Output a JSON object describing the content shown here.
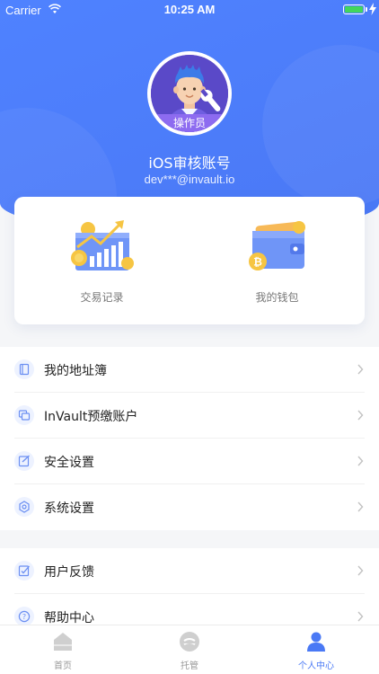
{
  "status_bar": {
    "carrier": "Carrier",
    "time": "10:25 AM"
  },
  "profile": {
    "role_badge": "操作员",
    "name": "iOS审核账号",
    "email": "dev***@invault.io"
  },
  "quick_actions": [
    {
      "label": "交易记录",
      "icon": "transaction-chart-icon"
    },
    {
      "label": "我的钱包",
      "icon": "wallet-icon"
    }
  ],
  "menu_groups": [
    [
      {
        "label": "我的地址簿",
        "icon": "address-book-icon"
      },
      {
        "label": "InVault预缴账户",
        "icon": "account-cards-icon"
      },
      {
        "label": "安全设置",
        "icon": "security-edit-icon"
      },
      {
        "label": "系统设置",
        "icon": "gear-icon"
      }
    ],
    [
      {
        "label": "用户反馈",
        "icon": "feedback-icon"
      },
      {
        "label": "帮助中心",
        "icon": "question-icon"
      }
    ]
  ],
  "tabs": [
    {
      "label": "首页",
      "icon": "home-icon",
      "active": false
    },
    {
      "label": "托管",
      "icon": "custody-icon",
      "active": false
    },
    {
      "label": "个人中心",
      "icon": "user-icon",
      "active": true
    }
  ],
  "colors": {
    "accent": "#4a79f5",
    "header": "#4f82ff",
    "badge": "#8d6bf0",
    "text": "#222222"
  }
}
